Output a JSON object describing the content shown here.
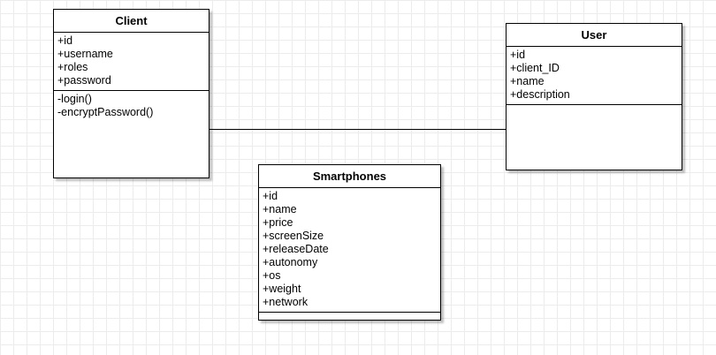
{
  "classes": {
    "client": {
      "name": "Client",
      "attributes": [
        "+id",
        "+username",
        "+roles",
        "+password"
      ],
      "methods": [
        "-login()",
        "-encryptPassword()"
      ]
    },
    "user": {
      "name": "User",
      "attributes": [
        "+id",
        "+client_ID",
        "+name",
        "+description"
      ],
      "methods": []
    },
    "smartphones": {
      "name": "Smartphones",
      "attributes": [
        "+id",
        "+name",
        "+price",
        "+screenSize",
        "+releaseDate",
        "+autonomy",
        "+os",
        "+weight",
        "+network"
      ],
      "methods": []
    }
  },
  "associations": [
    {
      "from": "Client",
      "to": "User"
    }
  ]
}
